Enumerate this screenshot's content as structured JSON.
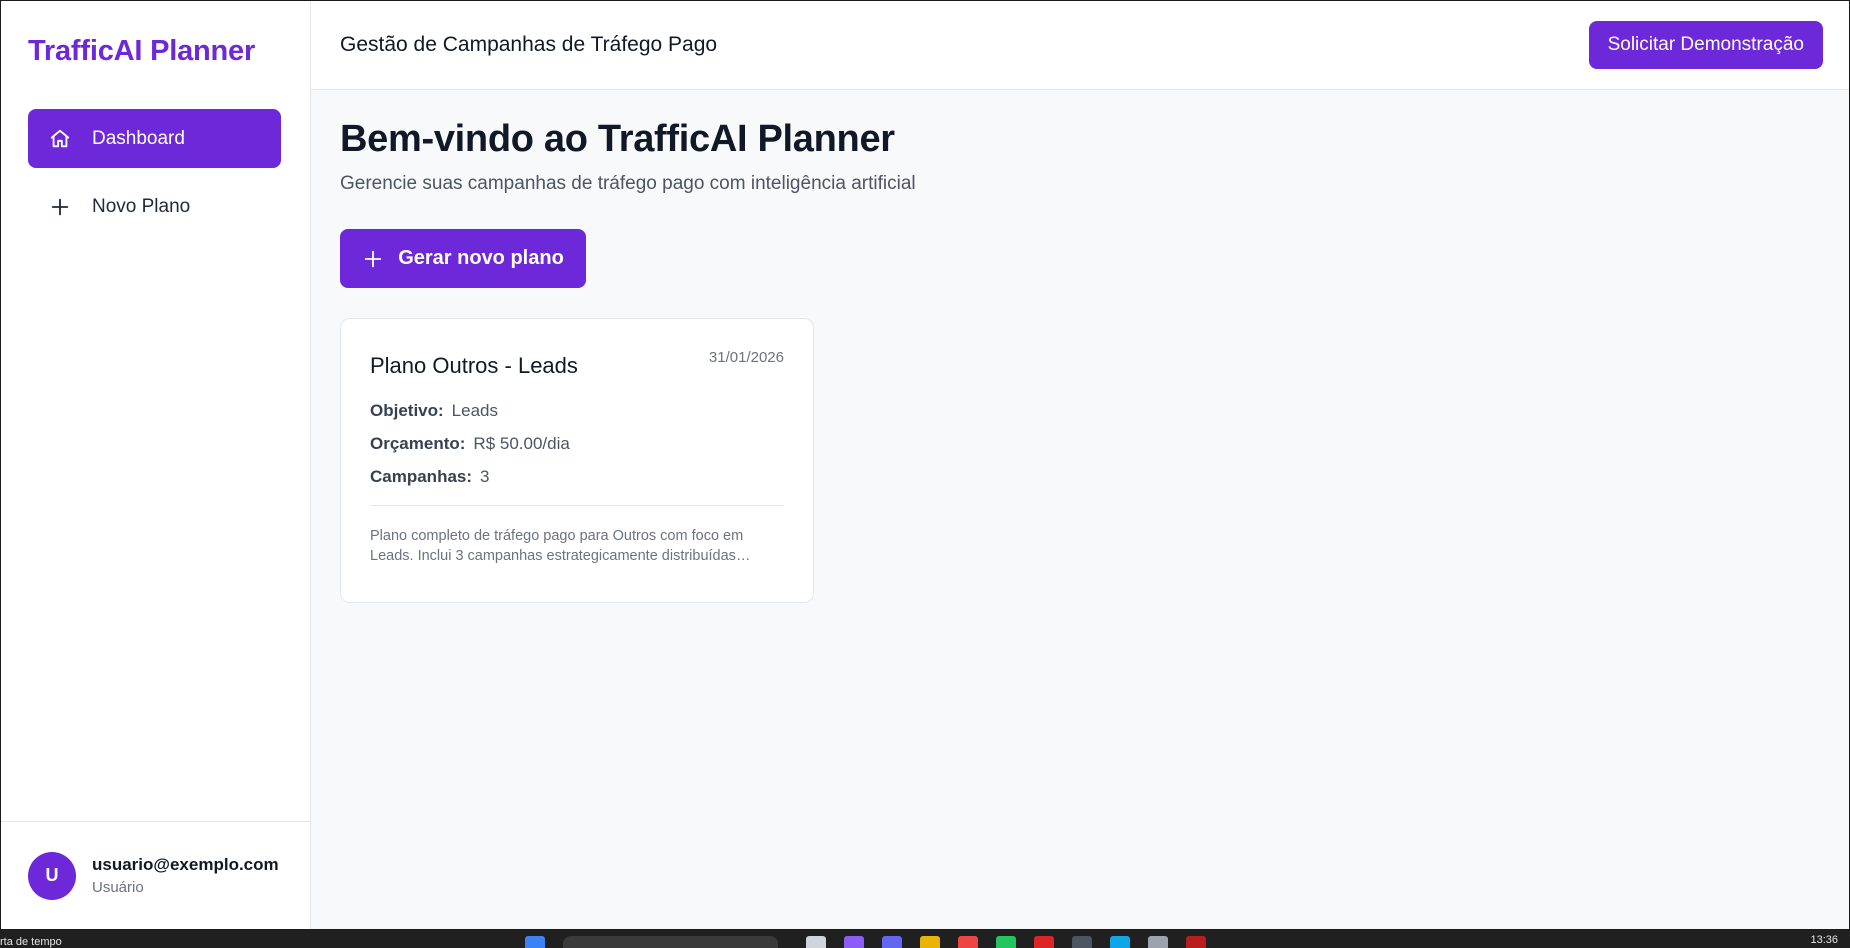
{
  "sidebar": {
    "brand": "TrafficAI Planner",
    "items": [
      {
        "label": "Dashboard",
        "icon": "home-icon",
        "active": true
      },
      {
        "label": "Novo Plano",
        "icon": "plus-icon",
        "active": false
      }
    ],
    "user": {
      "initial": "U",
      "email": "usuario@exemplo.com",
      "role": "Usuário"
    }
  },
  "header": {
    "title": "Gestão de Campanhas de Tráfego Pago",
    "demo_button": "Solicitar Demonstração"
  },
  "main": {
    "title": "Bem-vindo ao TrafficAI Planner",
    "subtitle": "Gerencie suas campanhas de tráfego pago com inteligência artificial",
    "generate_button": "Gerar novo plano",
    "plans": [
      {
        "title": "Plano Outros - Leads",
        "date": "31/01/2026",
        "objective_label": "Objetivo:",
        "objective": "Leads",
        "budget_label": "Orçamento:",
        "budget": "R$ 50.00/dia",
        "campaigns_label": "Campanhas:",
        "campaigns": "3",
        "description": "Plano completo de tráfego pago para Outros com foco em Leads. Inclui 3 campanhas estrategicamente distribuídas entre..."
      }
    ]
  },
  "taskbar": {
    "left_text": "rta de tempo",
    "clock": "13:36"
  },
  "colors": {
    "accent": "#6d28d9",
    "background": "#f8f9fb"
  }
}
